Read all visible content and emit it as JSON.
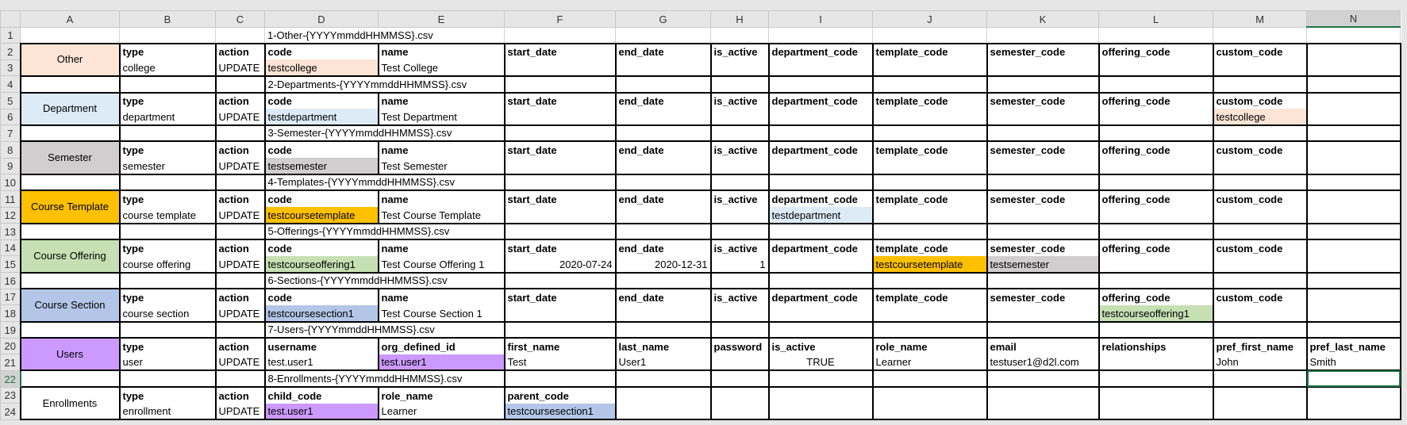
{
  "columns": [
    "A",
    "B",
    "C",
    "D",
    "E",
    "F",
    "G",
    "H",
    "I",
    "J",
    "K",
    "L",
    "M",
    "N"
  ],
  "selected_cell": {
    "column": "N",
    "row": 22
  },
  "first_file": "1-Other-{YYYYmmddHHMMSS}.csv",
  "blocks": [
    {
      "label": "Other",
      "color": "#fce4d6",
      "headers": [
        "type",
        "action",
        "code",
        "name",
        "start_date",
        "end_date",
        "is_active",
        "department_code",
        "template_code",
        "semester_code",
        "offering_code",
        "custom_code",
        ""
      ],
      "values": [
        "college",
        "UPDATE",
        "testcollege",
        "Test College",
        "",
        "",
        "",
        "",
        "",
        "",
        "",
        "",
        ""
      ],
      "highlights": {
        "2": "#fce4d6"
      }
    },
    {
      "label": "Department",
      "color": "#ddebf7",
      "file": "2-Departments-{YYYYmmddHHMMSS}.csv",
      "headers": [
        "type",
        "action",
        "code",
        "name",
        "start_date",
        "end_date",
        "is_active",
        "department_code",
        "template_code",
        "semester_code",
        "offering_code",
        "custom_code",
        ""
      ],
      "values": [
        "department",
        "UPDATE",
        "testdepartment",
        "Test Department",
        "",
        "",
        "",
        "",
        "",
        "",
        "",
        "testcollege",
        ""
      ],
      "highlights": {
        "2": "#ddebf7",
        "11": "#fce4d6"
      }
    },
    {
      "label": "Semester",
      "color": "#d0cece",
      "file": "3-Semester-{YYYYmmddHHMMSS}.csv",
      "headers": [
        "type",
        "action",
        "code",
        "name",
        "start_date",
        "end_date",
        "is_active",
        "department_code",
        "template_code",
        "semester_code",
        "offering_code",
        "custom_code",
        ""
      ],
      "values": [
        "semester",
        "UPDATE",
        "testsemester",
        "Test Semester",
        "",
        "",
        "",
        "",
        "",
        "",
        "",
        "",
        ""
      ],
      "highlights": {
        "2": "#d0cece"
      }
    },
    {
      "label": "Course Template",
      "color": "#ffc000",
      "file": "4-Templates-{YYYYmmddHHMMSS}.csv",
      "headers": [
        "type",
        "action",
        "code",
        "name",
        "start_date",
        "end_date",
        "is_active",
        "department_code",
        "template_code",
        "semester_code",
        "offering_code",
        "custom_code",
        ""
      ],
      "values": [
        "course template",
        "UPDATE",
        "testcoursetemplate",
        "Test Course Template",
        "",
        "",
        "",
        "testdepartment",
        "",
        "",
        "",
        "",
        ""
      ],
      "highlights": {
        "2": "#ffc000",
        "7": "#ddebf7"
      }
    },
    {
      "label": "Course Offering",
      "color": "#c6e0b4",
      "file": "5-Offerings-{YYYYmmddHHMMSS}.csv",
      "headers": [
        "type",
        "action",
        "code",
        "name",
        "start_date",
        "end_date",
        "is_active",
        "department_code",
        "template_code",
        "semester_code",
        "offering_code",
        "custom_code",
        ""
      ],
      "values": [
        "course offering",
        "UPDATE",
        "testcourseoffering1",
        "Test Course Offering 1",
        "2020-07-24",
        "2020-12-31",
        "1",
        "",
        "testcoursetemplate",
        "testsemester",
        "",
        "",
        ""
      ],
      "highlights": {
        "2": "#c6e0b4",
        "8": "#ffc000",
        "9": "#d0cece"
      }
    },
    {
      "label": "Course Section",
      "color": "#b4c6e7",
      "file": "6-Sections-{YYYYmmddHHMMSS}.csv",
      "headers": [
        "type",
        "action",
        "code",
        "name",
        "start_date",
        "end_date",
        "is_active",
        "department_code",
        "template_code",
        "semester_code",
        "offering_code",
        "custom_code",
        ""
      ],
      "values": [
        "course section",
        "UPDATE",
        "testcoursesection1",
        "Test Course Section 1",
        "",
        "",
        "",
        "",
        "",
        "",
        "testcourseoffering1",
        "",
        ""
      ],
      "highlights": {
        "2": "#b4c6e7",
        "10": "#c6e0b4"
      }
    },
    {
      "label": "Users",
      "color": "#cc99ff",
      "file": "7-Users-{YYYYmmddHHMMSS}.csv",
      "headers": [
        "type",
        "action",
        "username",
        "org_defined_id",
        "first_name",
        "last_name",
        "password",
        "is_active",
        "role_name",
        "email",
        "relationships",
        "pref_first_name",
        "pref_last_name"
      ],
      "values": [
        "user",
        "UPDATE",
        "test.user1",
        "test.user1",
        "Test",
        "User1",
        "",
        "TRUE",
        "Learner",
        "testuser1@d2l.com",
        "",
        "John",
        "Smith"
      ],
      "highlights": {
        "3": "#cc99ff"
      }
    },
    {
      "label": "Enrollments",
      "color": "#ffffff",
      "file": "8-Enrollments-{YYYYmmddHHMMSS}.csv",
      "headers": [
        "type",
        "action",
        "child_code",
        "role_name",
        "parent_code",
        "",
        "",
        "",
        "",
        "",
        "",
        "",
        ""
      ],
      "values": [
        "enrollment",
        "UPDATE",
        "test.user1",
        "Learner",
        "testcoursesection1",
        "",
        "",
        "",
        "",
        "",
        "",
        "",
        ""
      ],
      "highlights": {
        "2": "#cc99ff",
        "4": "#b4c6e7"
      }
    }
  ]
}
